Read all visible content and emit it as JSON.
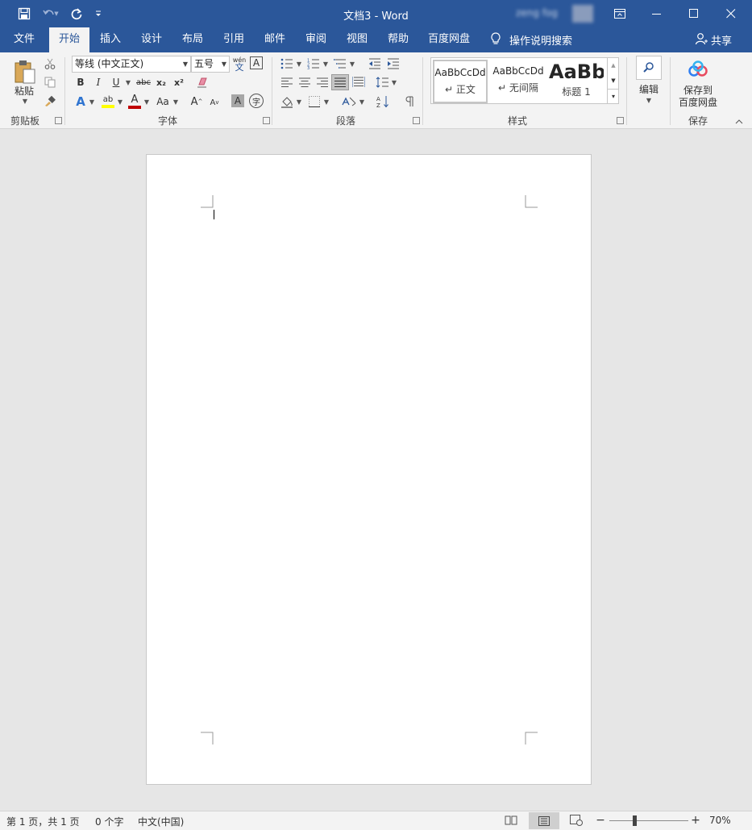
{
  "window": {
    "title": "文档3  -  Word",
    "user_name": "zeng fog",
    "controls": {
      "ribbon_display": "ribbon-display-icon",
      "minimize": "minimize-icon",
      "maximize": "maximize-icon",
      "close": "close-icon"
    }
  },
  "quick_access": {
    "save": "save-icon",
    "undo": "undo-icon",
    "redo": "redo-icon",
    "customize": "customize-qat-icon"
  },
  "tabs": [
    {
      "label": "文件"
    },
    {
      "label": "开始"
    },
    {
      "label": "插入"
    },
    {
      "label": "设计"
    },
    {
      "label": "布局"
    },
    {
      "label": "引用"
    },
    {
      "label": "邮件"
    },
    {
      "label": "审阅"
    },
    {
      "label": "视图"
    },
    {
      "label": "帮助"
    },
    {
      "label": "百度网盘"
    }
  ],
  "active_tab": "开始",
  "tell_me": "操作说明搜索",
  "share": "共享",
  "ribbon": {
    "clipboard": {
      "paste_label": "粘贴",
      "group_label": "剪贴板"
    },
    "font": {
      "font_name": "等线 (中文正文)",
      "font_size": "五号",
      "group_label": "字体",
      "phonetic_top": "wén",
      "phonetic_bottom": "文",
      "bold": "B",
      "italic": "I",
      "underline": "U",
      "strike": "abc",
      "subscript": "x₂",
      "superscript": "x²",
      "text_effects": "A",
      "highlight": "ab",
      "font_color": "A",
      "change_case": "Aa",
      "grow": "A",
      "shrink": "A",
      "char_shading": "A",
      "enclose": "字"
    },
    "paragraph": {
      "group_label": "段落"
    },
    "styles": {
      "group_label": "样式",
      "items": [
        {
          "sample": "AaBbCcDd",
          "name": "正文"
        },
        {
          "sample": "AaBbCcDd",
          "name": "无间隔"
        },
        {
          "sample": "AaBb",
          "name": "标题 1"
        }
      ]
    },
    "editing": {
      "label": "编辑"
    },
    "save_cloud": {
      "label_line1": "保存到",
      "label_line2": "百度网盘",
      "group_label": "保存"
    }
  },
  "status": {
    "page": "第 1 页，共 1 页",
    "words": "0 个字",
    "language": "中文(中国)",
    "zoom": "70%",
    "zoom_level": 0.7
  },
  "colors": {
    "brand": "#2b579a",
    "highlight_yellow": "#ffff00",
    "font_red": "#c00000",
    "baidu_blue": "#2f7ff2"
  }
}
